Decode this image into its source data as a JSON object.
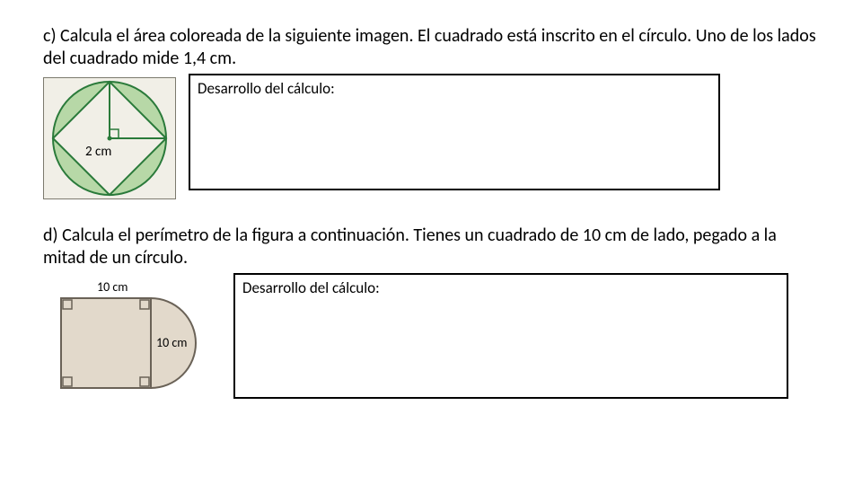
{
  "problem_c": {
    "prompt": "c) Calcula el área coloreada de la siguiente imagen. El cuadrado está inscrito en el círculo. Uno de los lados del cuadrado mide 1,4 cm.",
    "calc_label": "Desarrollo del cálculo:",
    "radius_label": "2 cm"
  },
  "problem_d": {
    "prompt": "d) Calcula el perímetro de la figura a continuación. Tienes un cuadrado de 10 cm de lado, pegado a la mitad de un círculo.",
    "calc_label": "Desarrollo del cálculo:",
    "top_label": "10 cm",
    "side_label": "10 cm"
  }
}
